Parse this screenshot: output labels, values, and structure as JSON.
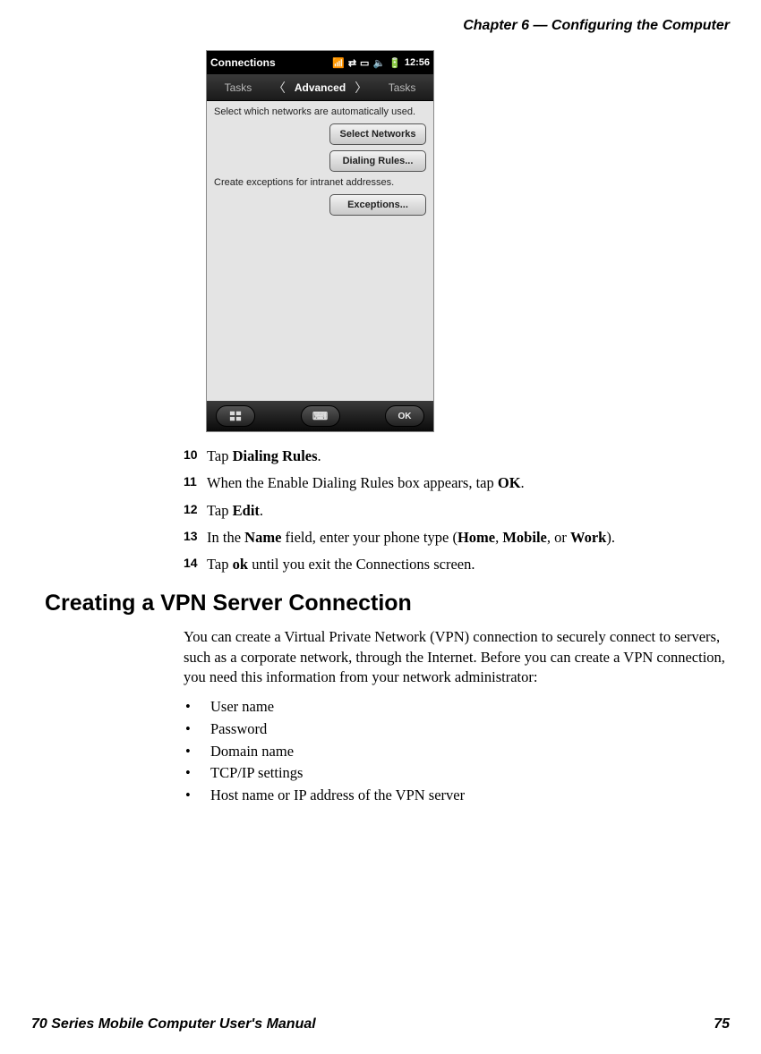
{
  "header": {
    "chapter": "Chapter 6 — Configuring the Computer"
  },
  "screenshot": {
    "titlebar": {
      "title": "Connections",
      "time": "12:56"
    },
    "tabs": {
      "left": "Tasks",
      "center": "Advanced",
      "right": "Tasks"
    },
    "instr1": "Select which networks are automatically used.",
    "btn_select_networks": "Select Networks",
    "btn_dialing_rules": "Dialing Rules...",
    "instr2": "Create exceptions for intranet addresses.",
    "btn_exceptions": "Exceptions...",
    "bottombar": {
      "ok": "OK"
    }
  },
  "steps": [
    {
      "num": "10",
      "parts": [
        "Tap ",
        "Dialing Rules",
        "."
      ]
    },
    {
      "num": "11",
      "parts": [
        "When the Enable Dialing Rules box appears, tap ",
        "OK",
        "."
      ]
    },
    {
      "num": "12",
      "parts": [
        "Tap ",
        "Edit",
        "."
      ]
    },
    {
      "num": "13",
      "parts": [
        "In the ",
        "Name",
        " field, enter your phone type (",
        "Home",
        ", ",
        "Mobile",
        ", or ",
        "Work",
        ")."
      ]
    },
    {
      "num": "14",
      "parts": [
        "Tap ",
        "ok",
        " until you exit the Connections screen."
      ]
    }
  ],
  "section_heading": "Creating a VPN Server Connection",
  "section_para": "You can create a Virtual Private Network (VPN) connection to securely connect to servers, such as a corporate network, through the Internet. Before you can create a VPN connection, you need this information from your network administrator:",
  "bullets": [
    "User name",
    "Password",
    "Domain name",
    "TCP/IP settings",
    "Host name or IP address of the VPN server"
  ],
  "footer": {
    "manual": "70 Series Mobile Computer User's Manual",
    "page": "75"
  }
}
